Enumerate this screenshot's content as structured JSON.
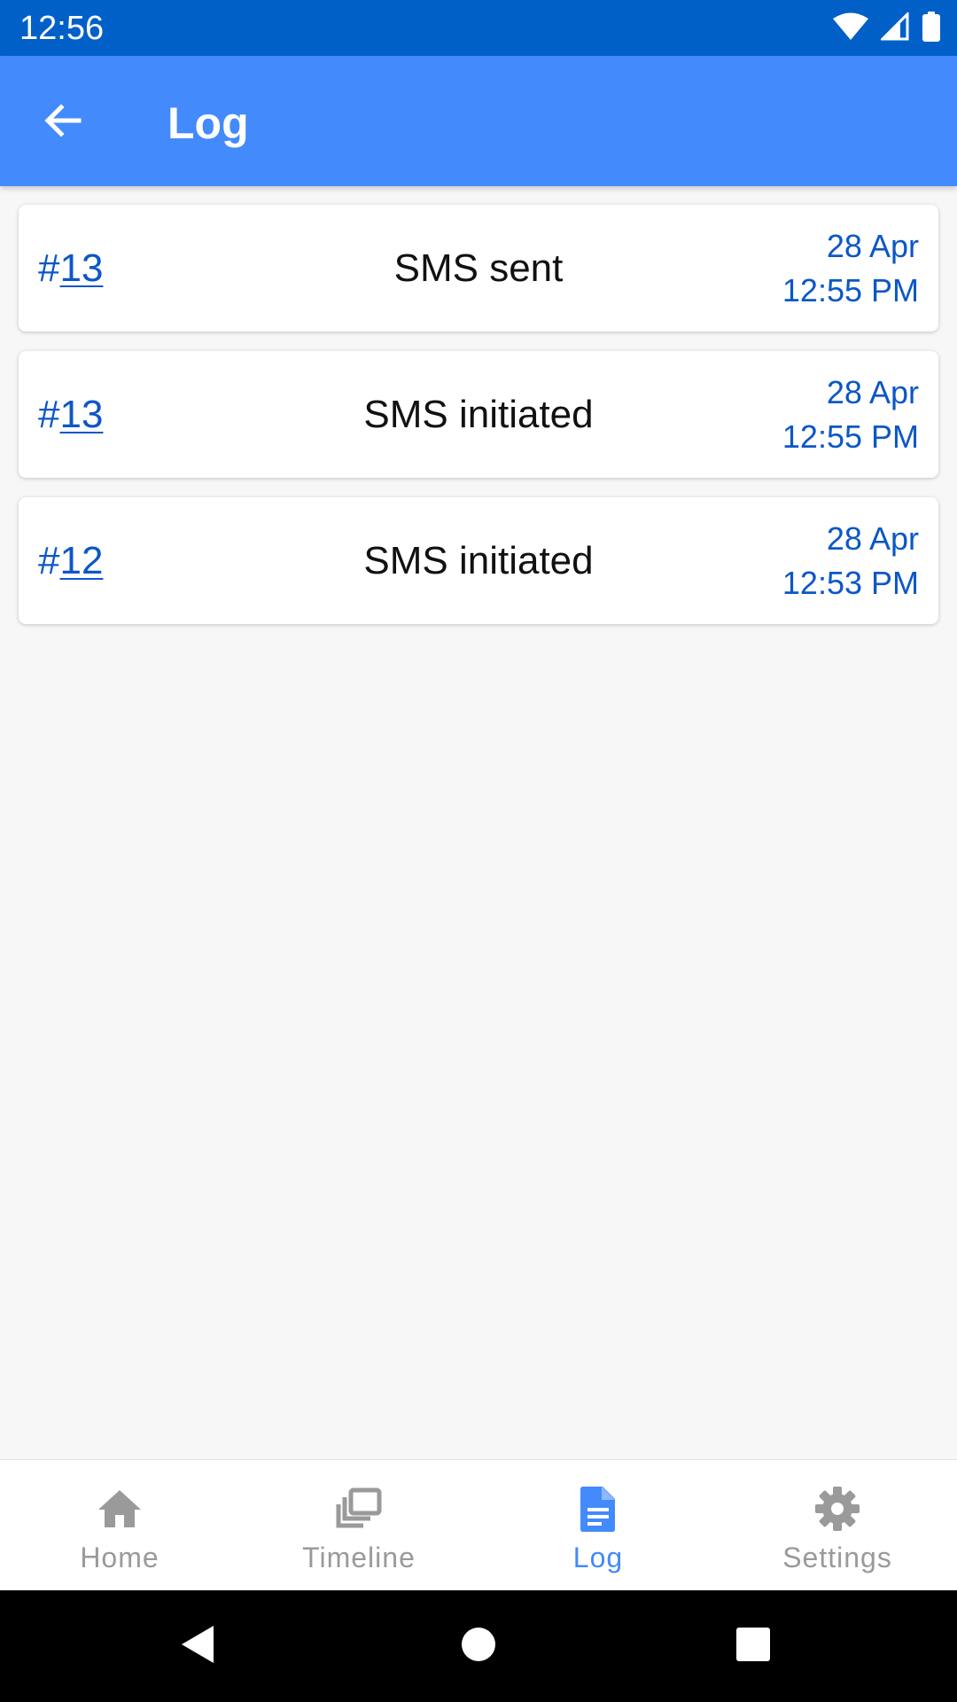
{
  "status_bar": {
    "time": "12:56"
  },
  "app_bar": {
    "title": "Log",
    "back_icon": "arrow-left-icon"
  },
  "log_entries": [
    {
      "id_prefix": "#",
      "id_number": "13",
      "event": "SMS sent",
      "date": "28 Apr",
      "time": "12:55 PM"
    },
    {
      "id_prefix": "#",
      "id_number": "13",
      "event": "SMS initiated",
      "date": "28 Apr",
      "time": "12:55 PM"
    },
    {
      "id_prefix": "#",
      "id_number": "12",
      "event": "SMS initiated",
      "date": "28 Apr",
      "time": "12:53 PM"
    }
  ],
  "bottom_nav": {
    "items": [
      {
        "label": "Home",
        "icon": "home-icon",
        "active": false
      },
      {
        "label": "Timeline",
        "icon": "timeline-icon",
        "active": false
      },
      {
        "label": "Log",
        "icon": "document-icon",
        "active": true
      },
      {
        "label": "Settings",
        "icon": "gear-icon",
        "active": false
      }
    ]
  },
  "colors": {
    "status_bar": "#0060c8",
    "app_bar": "#438afc",
    "link_blue": "#0b57c7",
    "nav_inactive": "#9a9a9a",
    "nav_active": "#438afc"
  }
}
